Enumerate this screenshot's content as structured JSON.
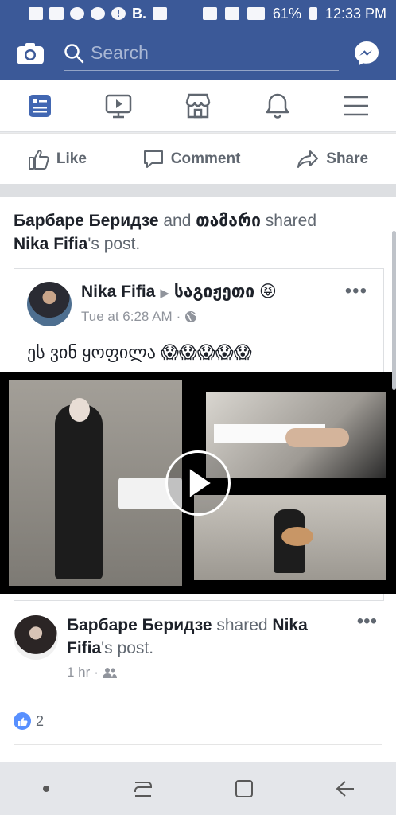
{
  "status": {
    "battery": "61%",
    "time": "12:33 PM",
    "letter": "B."
  },
  "search": {
    "placeholder": "Search"
  },
  "actions": {
    "like": "Like",
    "comment": "Comment",
    "share": "Share"
  },
  "post1": {
    "shared_a": "Барбаре Беридзе",
    "and": " and ",
    "shared_b": "თამარი",
    "shared_text": " shared",
    "owner": "Nika Fifia",
    "owner_suffix": "'s post.",
    "inner": {
      "author": "Nika Fifia",
      "target": "საგიჟეთი",
      "emoji": "😝",
      "time": "Tue at 6:28 AM",
      "text": "ეს ვინ ყოფილა 😱😱😱😱😱"
    }
  },
  "post2": {
    "author": "Барбаре Беридзе",
    "shared_text": " shared ",
    "owner": "Nika Fifia",
    "owner_suffix": "'s post.",
    "time": "1 hr",
    "likes": "2"
  },
  "colors": {
    "brand": "#3b5998",
    "like": "#5890ff"
  }
}
